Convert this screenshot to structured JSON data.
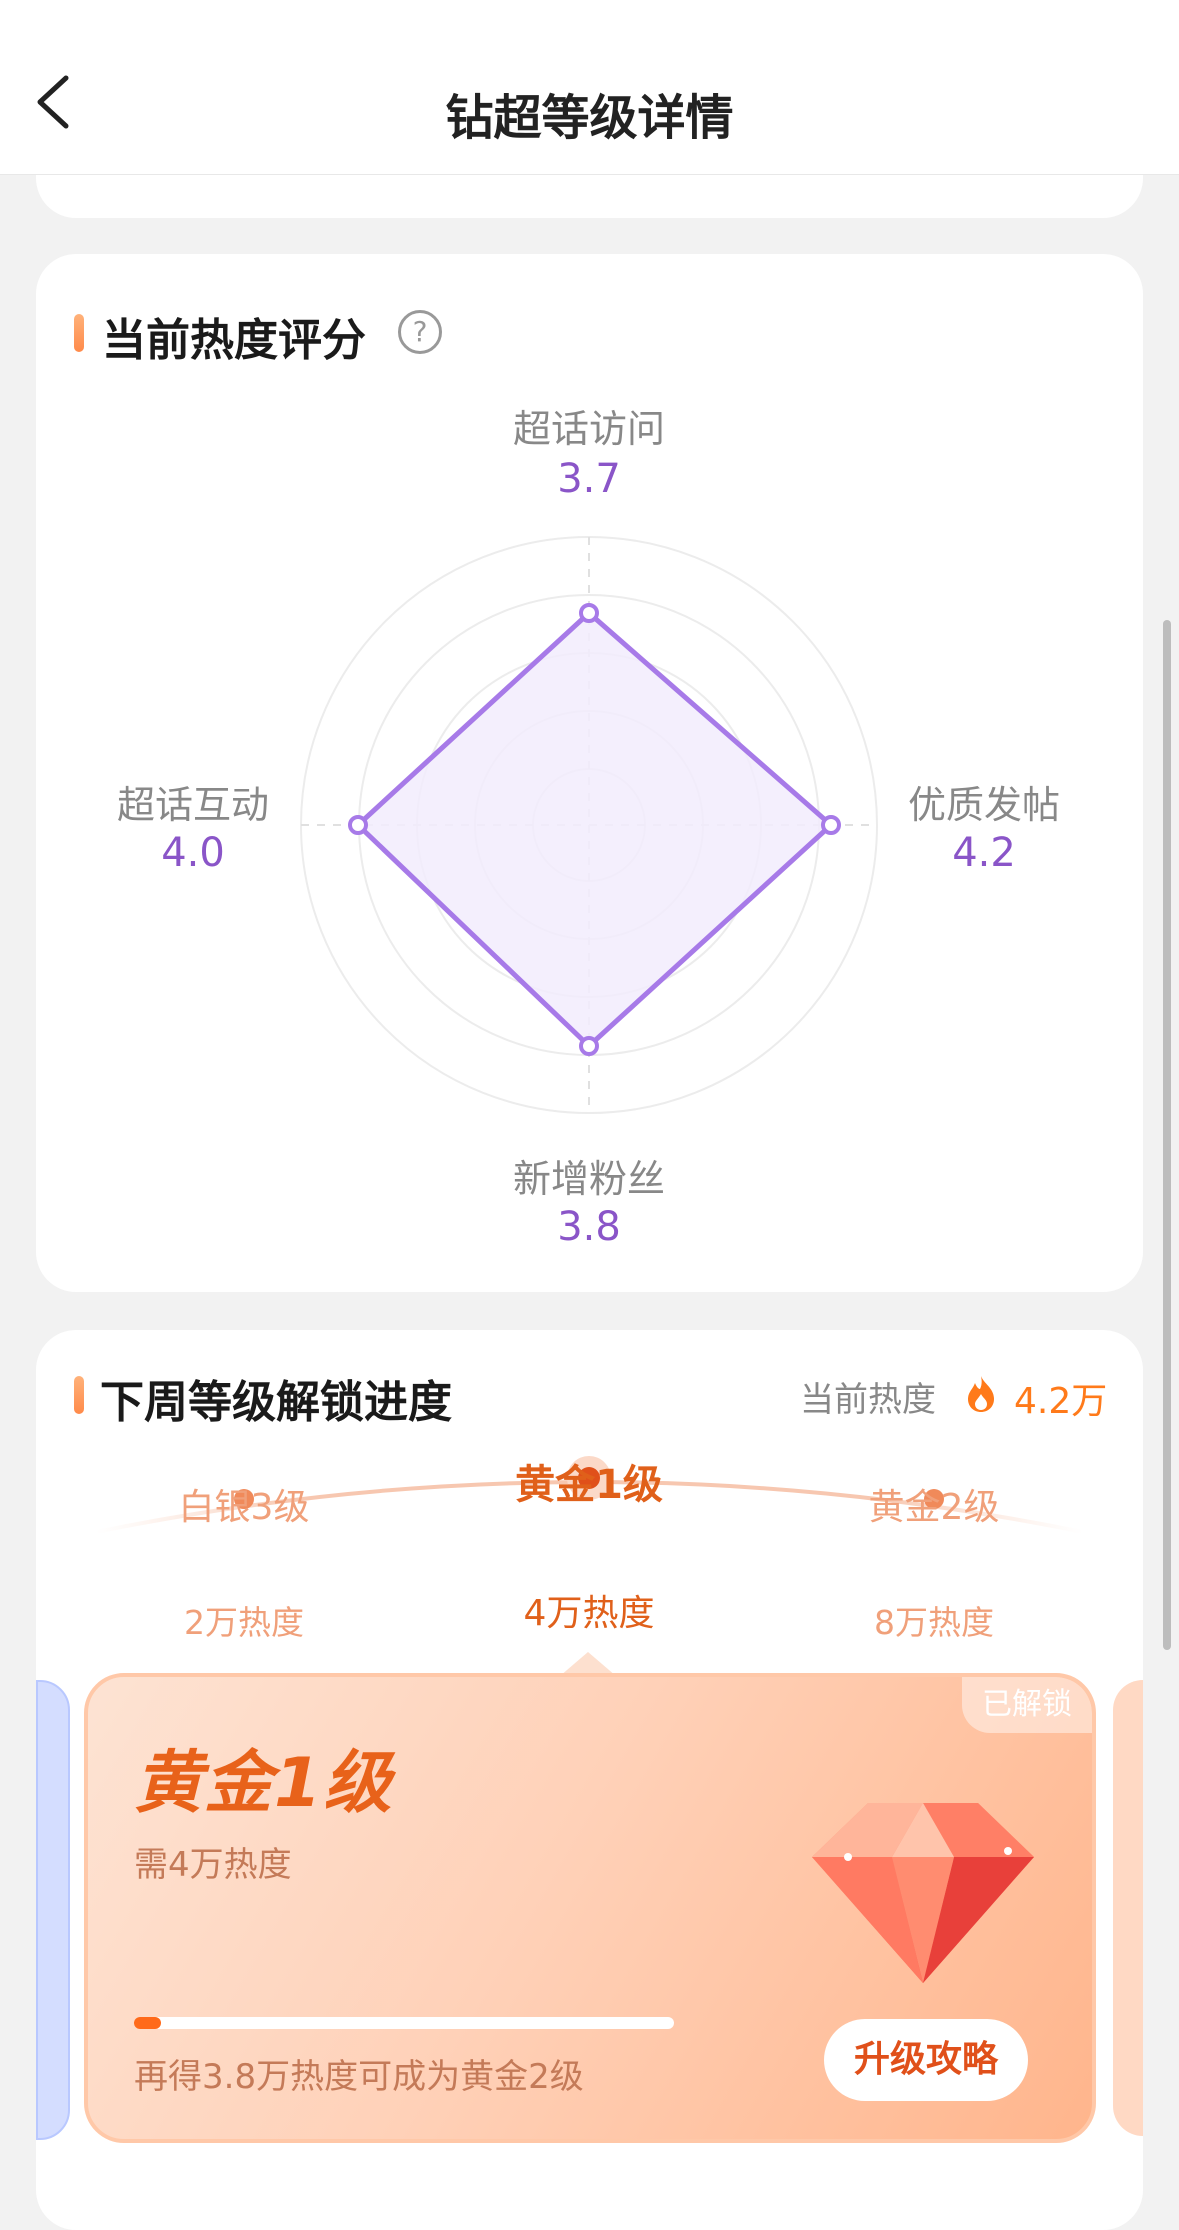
{
  "header": {
    "title": "钻超等级详情"
  },
  "heat_score": {
    "title": "当前热度评分",
    "help_glyph": "?",
    "axes": [
      {
        "label": "超话访问",
        "value": "3.7"
      },
      {
        "label": "优质发帖",
        "value": "4.2"
      },
      {
        "label": "新增粉丝",
        "value": "3.8"
      },
      {
        "label": "超话互动",
        "value": "4.0"
      }
    ],
    "colors": {
      "line": "#a77ae8",
      "fill": "#f2ecfd",
      "value": "#8a55c8"
    }
  },
  "unlock": {
    "title": "下周等级解锁进度",
    "current_heat_label": "当前热度",
    "current_heat_value": "4.2万",
    "levels": [
      {
        "name": "白银3级",
        "req": "2万热度"
      },
      {
        "name": "黄金1级",
        "req": "4万热度"
      },
      {
        "name": "黄金2级",
        "req": "8万热度"
      }
    ],
    "card": {
      "badge": "已解锁",
      "title": "黄金1级",
      "subtitle": "需4万热度",
      "tip": "再得3.8万热度可成为黄金2级",
      "button": "升级攻略",
      "progress": 0.05
    },
    "colors": {
      "accent": "#ff6a1a",
      "level_text": "#e0601a"
    }
  }
}
